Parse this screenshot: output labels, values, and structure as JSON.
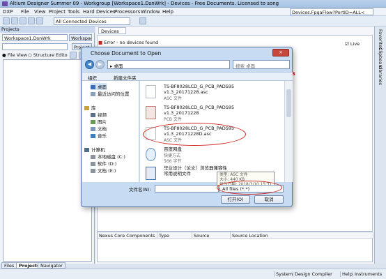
{
  "window": {
    "title": "Altium Designer Summer 09 - Workgroup [Workspace1.DsnWrk] - Devices - Free Documents. Licensed to song"
  },
  "menu": [
    "DXP",
    "File",
    "View",
    "Project",
    "Tools",
    "Hard Devices",
    "Processors",
    "Window",
    "Help"
  ],
  "toolbar": {
    "devices_combo": "All Connected Devices",
    "path_box": "Devices.FpgaFlow?PortID=ALL<"
  },
  "projects_panel": {
    "title": "Projects",
    "workspace_combo": "Workspace1.DsnWrk",
    "workspace_button": "Workspace",
    "project_button": "Project",
    "file_view_label": "File View",
    "structure_editor_label": "Structure Edito"
  },
  "left_tabs": [
    "Files",
    "Projects",
    "Navigator"
  ],
  "main": {
    "devices_tab": "Devices",
    "error_text": "Error - no devices found",
    "live_label": "Live",
    "devices_title": "ces",
    "table_headers": [
      "Nexus Core Components",
      "Type",
      "Source",
      "Source Location"
    ]
  },
  "right_strip": [
    "Favorites",
    "Clipboard",
    "Libraries"
  ],
  "status_bar": [
    "System",
    "Design Compiler",
    "Help",
    "Instruments"
  ],
  "dialog": {
    "title": "Choose Document to Open",
    "close_glyph": "×",
    "address": "桌面",
    "search_placeholder": "搜索 桌面",
    "commands": [
      "组织",
      "新建文件夹"
    ],
    "nav": [
      "桌面",
      "最近访问的位置",
      "库",
      "视频",
      "图片",
      "文档",
      "音乐",
      "计算机",
      "本地磁盘 (C:)",
      "软件 (D:)",
      "文档 (E:)"
    ],
    "files": [
      {
        "name": "TS-BF8028LCD_G_PCB_PADS95 v1.3_20171228.asc",
        "desc": "ASC 文件"
      },
      {
        "name": "TS-BF8028LCD_G_PCB_PADS95 v1.3_20171228",
        "desc": "PCB 文件"
      },
      {
        "name": "TS-BF8028LCD_G_PCB_PADS95 v1.3_20171228D.asc",
        "desc": "ASC 文件"
      },
      {
        "name": "百度网盘",
        "desc": "快捷方式",
        "size": "566 字节"
      },
      {
        "name": "毕业设计（论文）浏览器兼容性常用说明文件",
        "desc": ""
      }
    ],
    "tooltip": [
      "类型: ASC 文件",
      "大小: 440 KB",
      "修改日期: 2018/3/10 15:31"
    ],
    "filename_label": "文件名(N):",
    "filter": "All files (*.*)",
    "open_button": "打开(O)",
    "cancel_button": "取消"
  },
  "colors": {
    "accent": "#3f83c8",
    "error": "#cc2222",
    "annotation": "#d0221d"
  }
}
